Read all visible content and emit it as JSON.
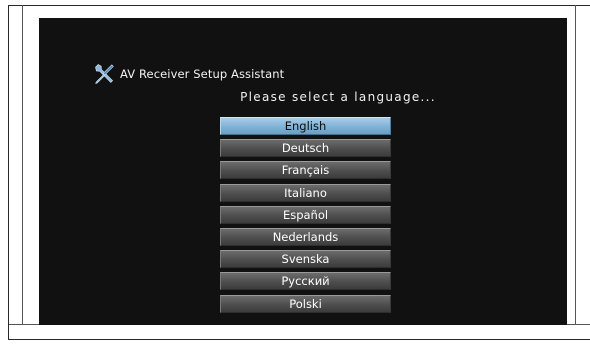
{
  "app": {
    "title": "AV Receiver Setup Assistant",
    "prompt": "Please select a language..."
  },
  "icons": {
    "tools": "tools-icon"
  },
  "colors": {
    "screen_background": "#111111",
    "selected_item": "#7fb2d6",
    "item": "#555555"
  },
  "languages": [
    {
      "label": "English",
      "selected": true
    },
    {
      "label": "Deutsch",
      "selected": false
    },
    {
      "label": "Français",
      "selected": false
    },
    {
      "label": "Italiano",
      "selected": false
    },
    {
      "label": "Español",
      "selected": false
    },
    {
      "label": "Nederlands",
      "selected": false
    },
    {
      "label": "Svenska",
      "selected": false
    },
    {
      "label": "Русский",
      "selected": false
    },
    {
      "label": "Polski",
      "selected": false
    }
  ]
}
